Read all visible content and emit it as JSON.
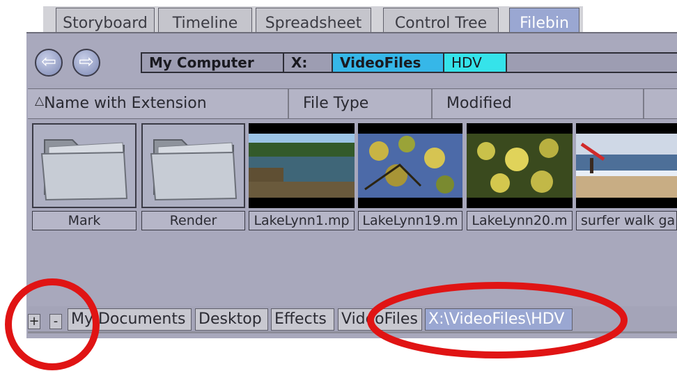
{
  "tabs": [
    "Storyboard",
    "Timeline",
    "Spreadsheet",
    "Control Tree",
    "Filebin"
  ],
  "active_tab": "Filebin",
  "nav": {
    "back_icon": "arrow-left-icon",
    "forward_icon": "arrow-right-icon"
  },
  "breadcrumb": [
    "My Computer",
    "X:",
    "VideoFiles",
    "HDV"
  ],
  "columns": [
    "Name with Extension",
    "File Type",
    "Modified"
  ],
  "sort_icon": "sort-ascending-icon",
  "files": [
    {
      "name": "Mark",
      "kind": "folder",
      "icon": "folder-icon"
    },
    {
      "name": "Render",
      "kind": "folder",
      "icon": "folder-icon"
    },
    {
      "name": "LakeLynn1.mp",
      "kind": "video",
      "icon": "video-thumbnail-lake"
    },
    {
      "name": "LakeLynn19.m",
      "kind": "video",
      "icon": "video-thumbnail-leaves"
    },
    {
      "name": "LakeLynn20.m",
      "kind": "video",
      "icon": "video-thumbnail-leaves"
    },
    {
      "name": "surfer walk ga",
      "kind": "video",
      "icon": "video-thumbnail-beach"
    }
  ],
  "bottom": {
    "add_label": "+",
    "remove_label": "-",
    "tabs": [
      "My Documents",
      "Desktop",
      "Effects",
      "VideoFiles",
      "X:\\VideoFiles\\HDV"
    ],
    "active_tab": "X:\\VideoFiles\\HDV"
  },
  "colors": {
    "panel": "#a8a8bc",
    "active_tab": "#9aa7d2",
    "crumb_videofiles": "#36b7e8",
    "crumb_hdv": "#35e3ea",
    "annotation": "#e01414"
  }
}
